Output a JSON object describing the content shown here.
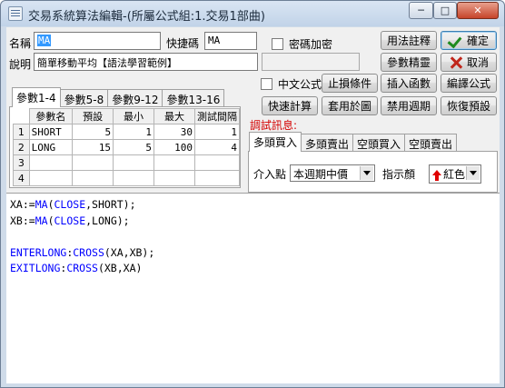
{
  "window": {
    "title": "交易系統算法編輯-(所屬公式組:1.交易1部曲)",
    "min_glyph": "─",
    "max_glyph": "□",
    "close_glyph": "✕"
  },
  "form": {
    "name_label": "名稱",
    "name_value": "MA",
    "shortcut_label": "快捷碼",
    "shortcut_value": "MA",
    "password_label": "密碼加密",
    "description_label": "說明",
    "description_value": "簡單移動平均【語法學習範例】",
    "chinese_formula_label": "中文公式"
  },
  "buttons": {
    "syntax_notes": "用法註釋",
    "ok": "確定",
    "param_wizard": "參數精靈",
    "cancel": "取消",
    "stop_loss": "止損條件",
    "insert_function": "插入函數",
    "compile": "編譯公式",
    "quick_calc": "快速計算",
    "apply_chart": "套用於圖",
    "disable_period": "禁用週期",
    "restore_default": "恢復預設"
  },
  "param_tabs": [
    "參數1-4",
    "參數5-8",
    "參數9-12",
    "參數13-16"
  ],
  "param_table": {
    "headers": [
      "參數名",
      "預設",
      "最小",
      "最大",
      "測試間隔"
    ],
    "rows": [
      {
        "n": "1",
        "name": "SHORT",
        "default": "5",
        "min": "1",
        "max": "30",
        "step": "1"
      },
      {
        "n": "2",
        "name": "LONG",
        "default": "15",
        "min": "5",
        "max": "100",
        "step": "4"
      },
      {
        "n": "3",
        "name": "",
        "default": "",
        "min": "",
        "max": "",
        "step": ""
      },
      {
        "n": "4",
        "name": "",
        "default": "",
        "min": "",
        "max": "",
        "step": ""
      }
    ]
  },
  "debug": {
    "label": "調試訊息:",
    "tabs": [
      "多頭買入",
      "多頭賣出",
      "空頭買入",
      "空頭賣出"
    ],
    "entry_label": "介入點",
    "entry_value": "本週期中價",
    "indicator_label": "指示顏",
    "indicator_value": "紅色",
    "indicator_color": "#e00000"
  },
  "code": [
    [
      {
        "t": "XA:="
      },
      {
        "t": "MA",
        "k": true
      },
      {
        "t": "("
      },
      {
        "t": "CLOSE",
        "k": true
      },
      {
        "t": ",SHORT);"
      }
    ],
    [
      {
        "t": "XB:="
      },
      {
        "t": "MA",
        "k": true
      },
      {
        "t": "("
      },
      {
        "t": "CLOSE",
        "k": true
      },
      {
        "t": ",LONG);"
      }
    ],
    [],
    [
      {
        "t": "ENTERLONG",
        "k": true
      },
      {
        "t": ":"
      },
      {
        "t": "CROSS",
        "k": true
      },
      {
        "t": "(XA,XB);"
      }
    ],
    [
      {
        "t": "EXITLONG",
        "k": true
      },
      {
        "t": ":"
      },
      {
        "t": "CROSS",
        "k": true
      },
      {
        "t": "(XB,XA)"
      }
    ]
  ]
}
